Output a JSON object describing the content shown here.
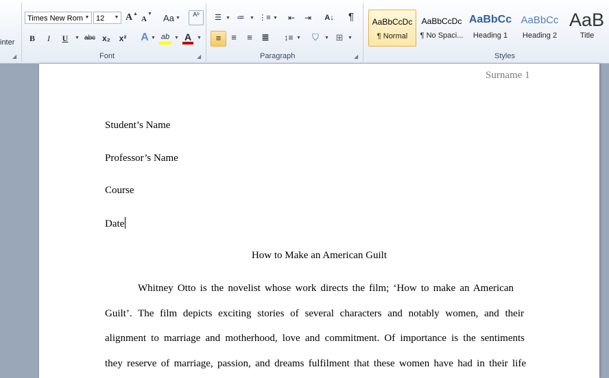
{
  "ribbon": {
    "clipboard_fragment": "inter",
    "font": {
      "label": "Font",
      "font_name": "Times New Rom",
      "font_size": "12",
      "grow_label": "A",
      "shrink_label": "A",
      "case_label": "Aa",
      "bold": "B",
      "italic": "I",
      "underline": "U",
      "strike": "abc",
      "subscript": "x₂",
      "superscript": "x²",
      "effects": "A",
      "highlight": "ab",
      "font_color": "A",
      "highlight_color": "#ffff00",
      "font_color_value": "#c00000"
    },
    "paragraph": {
      "label": "Paragraph",
      "sort": "A↓",
      "pilcrow": "¶"
    },
    "styles": {
      "label": "Styles",
      "items": [
        {
          "sample": "AaBbCcDc",
          "name": "¶ Normal",
          "selected": true
        },
        {
          "sample": "AaBbCcDc",
          "name": "¶ No Spaci..."
        },
        {
          "sample": "AaBbCc",
          "name": "Heading 1"
        },
        {
          "sample": "AaBbCc",
          "name": "Heading 2"
        },
        {
          "sample": "AaB",
          "name": "Title"
        }
      ]
    }
  },
  "document": {
    "header": "Surname 1",
    "student": "Student’s Name",
    "professor": "Professor’s Name",
    "course": "Course",
    "date": "Date",
    "title": "How to Make an American Guilt",
    "para_lines": [
      "Whitney Otto is the novelist whose work directs the film; ‘How to make an American",
      "Guilt’. The film depicts exciting stories of several characters and notably women, and their",
      "alignment to marriage and motherhood, love and commitment. Of importance is the sentiments",
      "they reserve of marriage, passion, and dreams fulfilment that these women have had in their life"
    ]
  }
}
